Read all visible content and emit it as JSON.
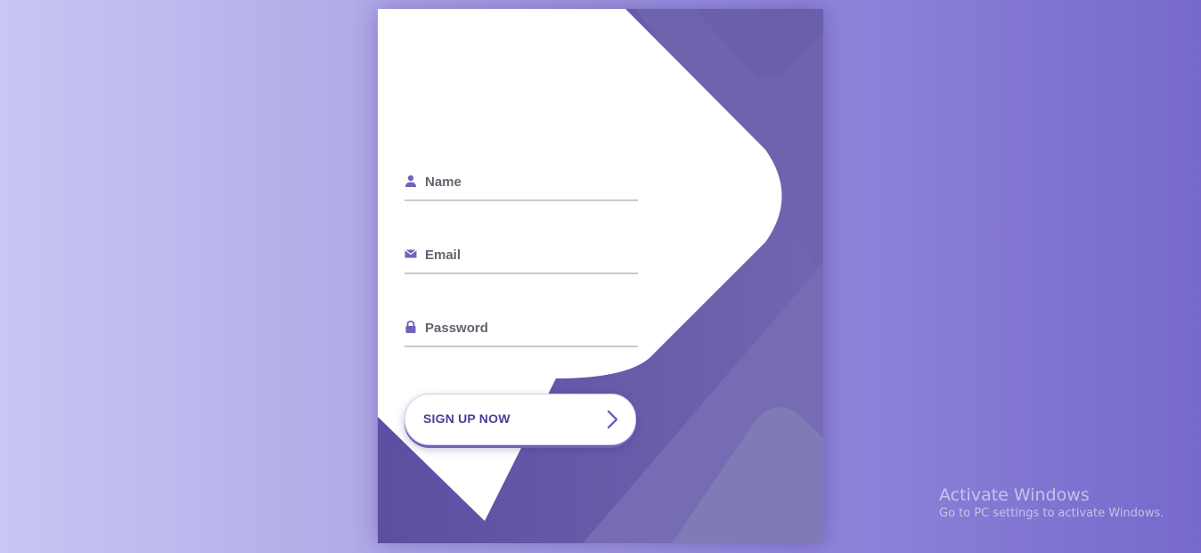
{
  "form": {
    "fields": [
      {
        "name": "name",
        "placeholder": "Name",
        "icon": "user-icon",
        "type": "text"
      },
      {
        "name": "email",
        "placeholder": "Email",
        "icon": "envelope-icon",
        "type": "email"
      },
      {
        "name": "password",
        "placeholder": "Password",
        "icon": "lock-icon",
        "type": "password"
      }
    ],
    "submit": {
      "label": "SIGN UP NOW",
      "icon": "chevron-right-icon"
    }
  },
  "watermark": {
    "title": "Activate Windows",
    "subtitle": "Go to PC settings to activate Windows."
  },
  "colors": {
    "accent": "#5b4ea1",
    "icon": "#6f62b8",
    "button_text": "#4c3f98",
    "input_text": "#63636f"
  }
}
